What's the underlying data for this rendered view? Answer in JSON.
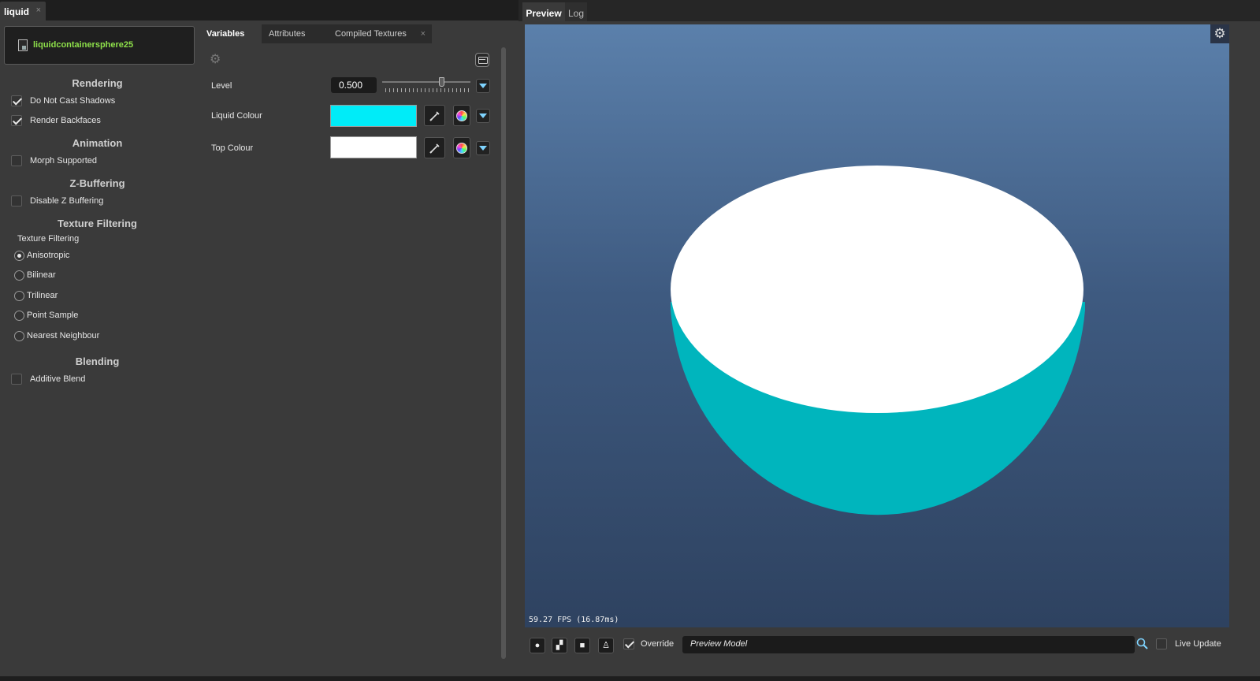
{
  "left_window": {
    "tab_label": "liquid",
    "tab_close": "×",
    "material_name": "liquidcontainersphere25"
  },
  "options": {
    "rendering": {
      "title": "Rendering",
      "do_not_cast_shadows": {
        "label": "Do Not Cast Shadows",
        "checked": true
      },
      "render_backfaces": {
        "label": "Render Backfaces",
        "checked": true
      }
    },
    "animation": {
      "title": "Animation",
      "morph_supported": {
        "label": "Morph Supported",
        "checked": false
      }
    },
    "z_buffering": {
      "title": "Z-Buffering",
      "disable_z_buffering": {
        "label": "Disable Z Buffering",
        "checked": false
      }
    },
    "texture_filtering": {
      "title": "Texture Filtering",
      "sub_label": "Texture Filtering",
      "options": [
        {
          "label": "Anisotropic",
          "selected": true
        },
        {
          "label": "Bilinear",
          "selected": false
        },
        {
          "label": "Trilinear",
          "selected": false
        },
        {
          "label": "Point Sample",
          "selected": false
        },
        {
          "label": "Nearest Neighbour",
          "selected": false
        }
      ]
    },
    "blending": {
      "title": "Blending",
      "additive_blend": {
        "label": "Additive Blend",
        "checked": false
      }
    }
  },
  "variables_pane": {
    "tabs": [
      {
        "label": "Variables",
        "active": true
      },
      {
        "label": "Attributes",
        "active": false
      },
      {
        "label": "Compiled Textures",
        "active": false
      }
    ],
    "tab_close": "×",
    "variables": {
      "level": {
        "label": "Level",
        "value": "0.500",
        "fraction": 0.5
      },
      "liquid_colour": {
        "label": "Liquid Colour",
        "color": "#00ecf8"
      },
      "top_colour": {
        "label": "Top Colour",
        "color": "#ffffff"
      }
    }
  },
  "preview_window": {
    "tabs": [
      {
        "label": "Preview",
        "active": true
      },
      {
        "label": "Log",
        "active": false
      }
    ],
    "fps_text": "59.27 FPS (16.87ms)",
    "colors": {
      "liquid_side": "#00b5bd",
      "liquid_top": "#ffffff"
    },
    "toolbar": {
      "buttons": [
        {
          "icon": "sphere-icon",
          "glyph": "●"
        },
        {
          "icon": "cube-icon",
          "glyph": "▞"
        },
        {
          "icon": "plane-icon",
          "glyph": "■"
        },
        {
          "icon": "figure-icon",
          "glyph": "♙"
        }
      ],
      "override": {
        "label": "Override",
        "checked": true
      },
      "preview_model": "Preview Model",
      "live_update": {
        "label": "Live Update",
        "checked": false
      }
    }
  }
}
